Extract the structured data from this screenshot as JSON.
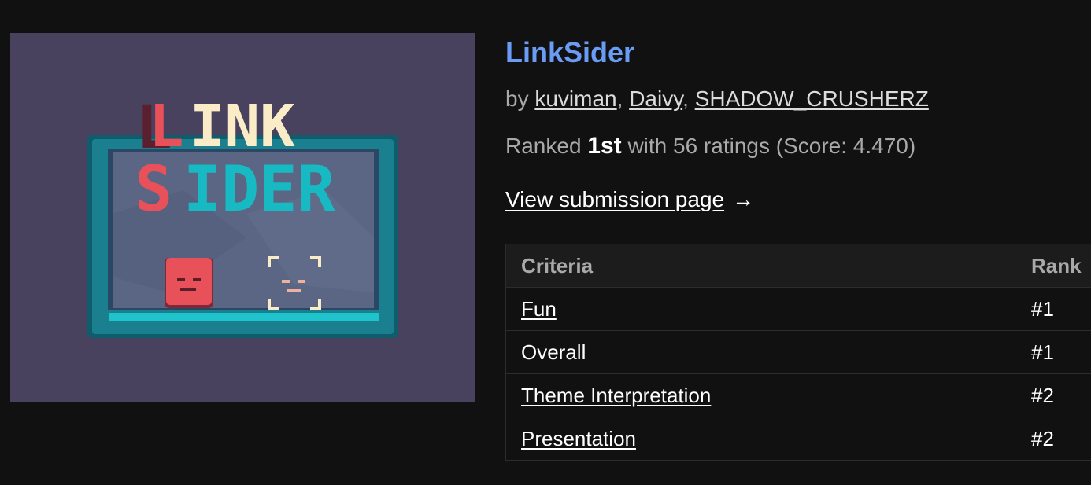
{
  "game": {
    "title": "LinkSider",
    "logo_line1": "LINK",
    "logo_line2": "SIDER",
    "by_prefix": "by",
    "authors": [
      "kuviman",
      "Daivy",
      "SHADOW_CRUSHERZ"
    ],
    "separator": ", ",
    "rank_prefix": "Ranked",
    "rank": "1st",
    "rank_suffix": "with 56 ratings (Score: 4.470)",
    "view_link": "View submission page",
    "view_arrow": "→"
  },
  "table": {
    "headers": {
      "criteria": "Criteria",
      "rank": "Rank"
    },
    "rows": [
      {
        "criteria": "Fun",
        "rank": "#1",
        "linked": true
      },
      {
        "criteria": "Overall",
        "rank": "#1",
        "linked": false
      },
      {
        "criteria": "Theme Interpretation",
        "rank": "#2",
        "linked": true
      },
      {
        "criteria": "Presentation",
        "rank": "#2",
        "linked": true
      }
    ]
  },
  "colors": {
    "background": "#111111",
    "title": "#6a9cf5",
    "thumb_bg": "#48425f",
    "logo_red": "#e8505a",
    "logo_cream": "#fbecc8",
    "logo_teal": "#17b9c2",
    "frame_teal": "#1a7f8e"
  }
}
